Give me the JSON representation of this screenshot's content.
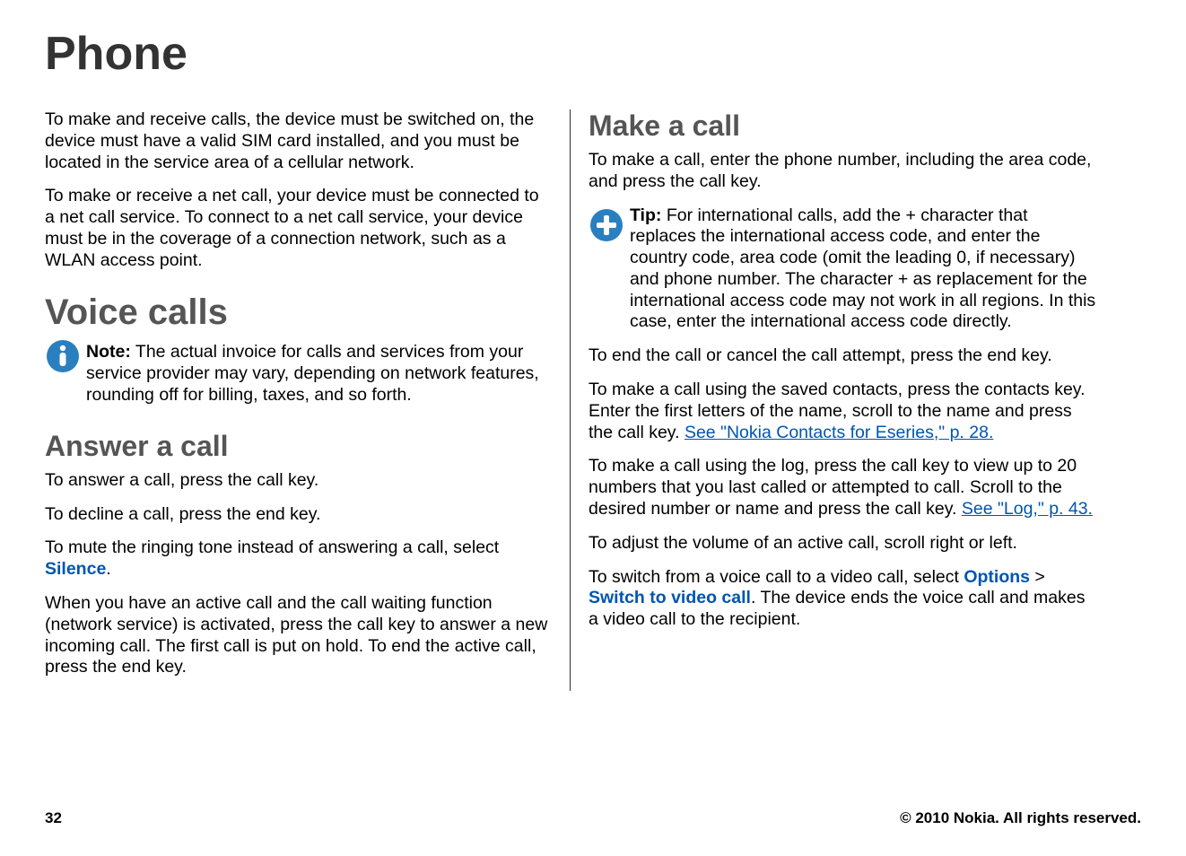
{
  "chapter": {
    "title": "Phone"
  },
  "left": {
    "p1": "To make and receive calls, the device must be switched on, the device must have a valid SIM card installed, and you must be located in the service area of a cellular network.",
    "p2": "To make or receive a net call, your device must be connected to a net call service. To connect to a net call service, your device must be in the coverage of a connection network, such as a WLAN access point.",
    "h2_voice_calls": "Voice calls",
    "note_label": "Note:",
    "note_text": "The actual invoice for calls and services from your service provider may vary, depending on network features, rounding off for billing, taxes, and so forth.",
    "h3_answer": "Answer a call",
    "p_answer": "To answer a call, press the call key.",
    "p_decline": "To decline a call, press the end key.",
    "p_mute_1": "To mute the ringing tone instead of answering a call, select ",
    "silence_label": "Silence",
    "p_mute_2": ".",
    "p_waiting": "When you have an active call and the call waiting function (network service) is activated, press the call key to answer a new incoming call. The first call is put on hold. To end the active call, press the end key."
  },
  "right": {
    "h3_make": "Make a call",
    "p_make": "To make a call, enter the phone number, including the area code, and press the call key.",
    "tip_label": "Tip:",
    "tip_text": "For international calls, add the + character that replaces the international access code, and enter the country code, area code (omit the leading 0, if necessary) and phone number. The character + as replacement for the international access code may not work in all regions. In this case, enter the international access code directly.",
    "p_end": "To end the call or cancel the call attempt, press the end key.",
    "p_contacts_1": "To make a call using the saved contacts, press the contacts key. Enter the first letters of the name, scroll to the name and press the call key. ",
    "link_contacts": "See \"Nokia Contacts for Eseries,\" p. 28.",
    "p_log_1": "To make a call using the log, press the call key to view up to 20 numbers that you last called or attempted to call. Scroll to the desired number or name and press the call key. ",
    "link_log": "See \"Log,\" p. 43.",
    "p_volume": "To adjust the volume of an active call, scroll right or left.",
    "p_video_1": "To switch from a voice call to a video call, select ",
    "options_label": "Options",
    "arrow": " > ",
    "switch_label": "Switch to video call",
    "p_video_2": ". The device ends the voice call and makes a video call to the recipient."
  },
  "footer": {
    "page": "32",
    "copyright": "© 2010 Nokia. All rights reserved."
  }
}
